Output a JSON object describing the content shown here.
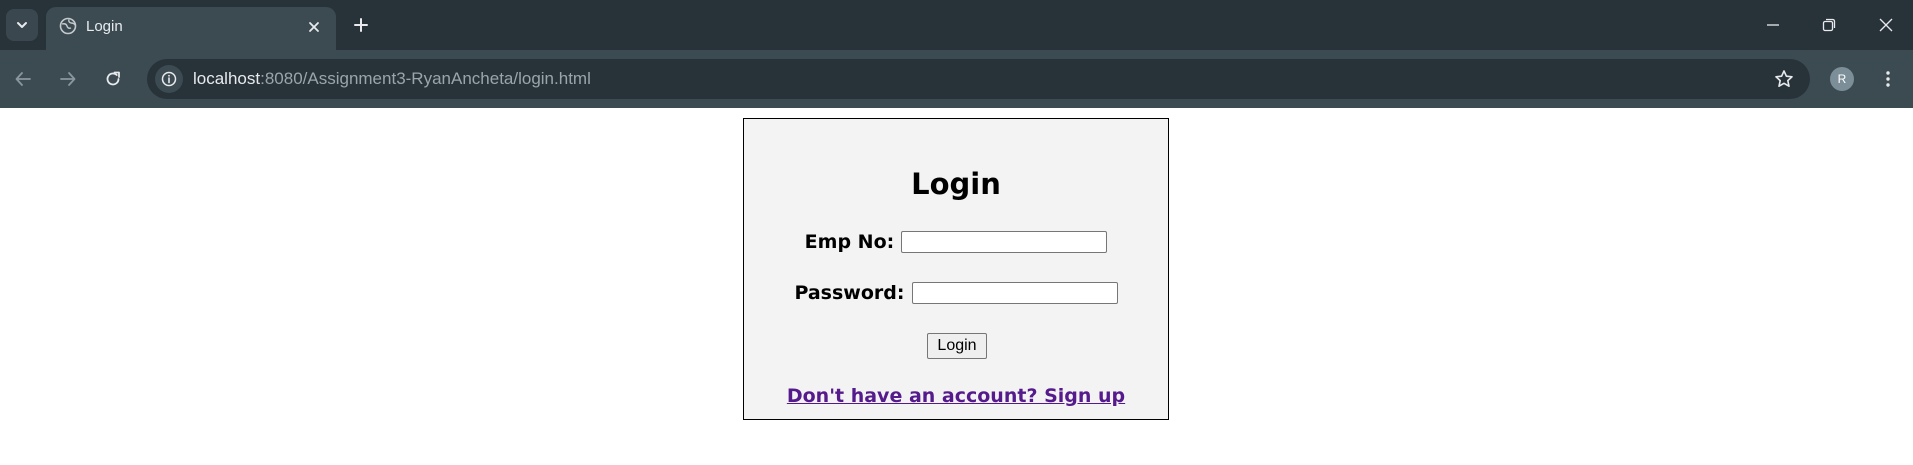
{
  "browser": {
    "tab": {
      "title": "Login"
    },
    "address_bar": {
      "host": "localhost",
      "path": ":8080/Assignment3-RyanAncheta/login.html"
    },
    "profile_initial": "R",
    "icons": {
      "tab_search": "chevron-down-icon",
      "favicon": "globe-icon",
      "tab_close": "close-icon",
      "new_tab": "plus-icon",
      "back": "arrow-left-icon",
      "forward": "arrow-right-icon",
      "reload": "reload-icon",
      "site_info": "info-icon",
      "bookmark": "star-icon",
      "menu": "kebab-menu-icon",
      "minimize": "minimize-icon",
      "restore": "restore-icon",
      "close_window": "close-icon"
    },
    "colors": {
      "tabbar": "#283339",
      "toolbar": "#3c4b52"
    }
  },
  "page": {
    "title": "Login",
    "emp_no_label": "Emp No:",
    "emp_no_value": "",
    "password_label": "Password:",
    "password_value": "",
    "submit_label": "Login",
    "signup_link": "Don't have an account? Sign up",
    "colors": {
      "panel_background": "#f3f3f3",
      "link": "#551a8b"
    }
  }
}
